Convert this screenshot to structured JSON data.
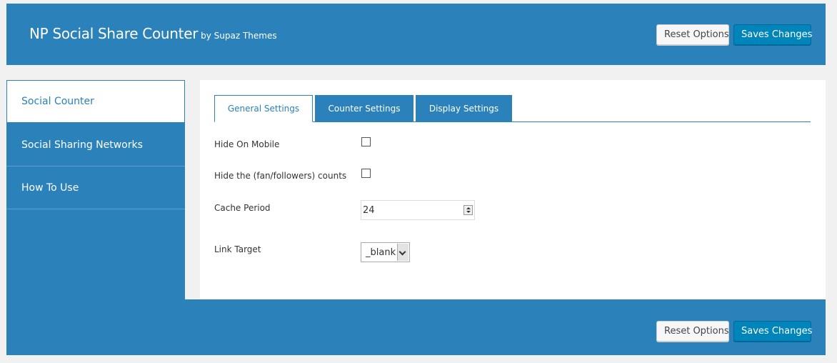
{
  "header": {
    "title": "NP Social Share Counter",
    "byline": "by Supaz Themes",
    "reset_label": "Reset Options",
    "save_label": "Saves Changes"
  },
  "sidebar": {
    "items": [
      {
        "label": "Social Counter",
        "active": true
      },
      {
        "label": "Social Sharing Networks",
        "active": false
      },
      {
        "label": "How To Use",
        "active": false
      }
    ]
  },
  "tabs": [
    {
      "label": "General Settings",
      "active": true
    },
    {
      "label": "Counter Settings",
      "active": false
    },
    {
      "label": "Display Settings",
      "active": false
    }
  ],
  "settings": {
    "hide_on_mobile": {
      "label": "Hide On Mobile",
      "checked": false
    },
    "hide_counts": {
      "label": "Hide the (fan/followers) counts",
      "checked": false
    },
    "cache_period": {
      "label": "Cache Period",
      "value": "24"
    },
    "link_target": {
      "label": "Link Target",
      "value": "_blank"
    }
  },
  "footer": {
    "reset_label": "Reset Options",
    "save_label": "Saves Changes"
  },
  "colors": {
    "brand_blue": "#2b81ba",
    "primary_button": "#0085ba",
    "page_background": "#f1f1f1"
  }
}
